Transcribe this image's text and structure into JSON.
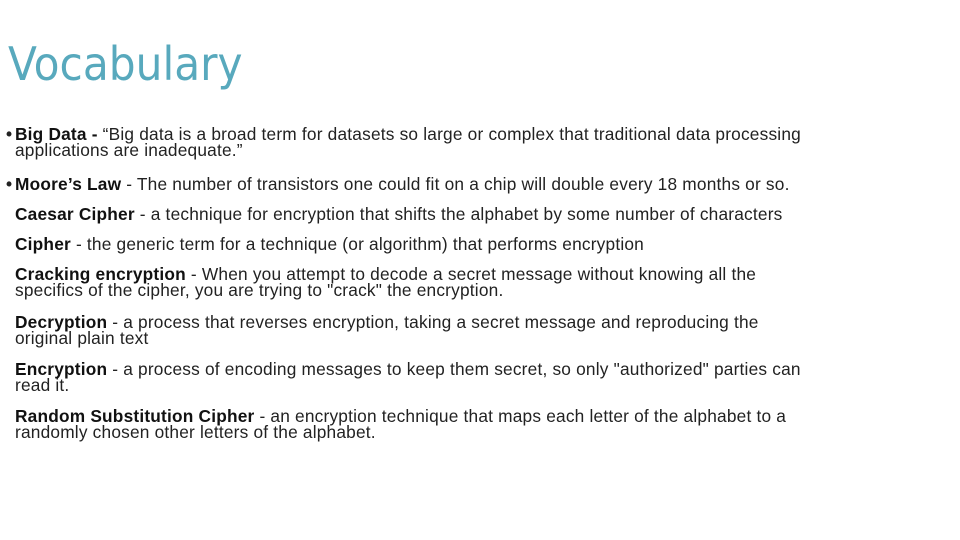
{
  "slide": {
    "title": "Vocabulary",
    "title_color": "#58a9bd",
    "entries": [
      {
        "bullet": "•",
        "term": "Big Data",
        "separator": " - ",
        "line1": "“Big data is a broad term for datasets so large or complex that traditional data processing",
        "line2": "applications are inadequate.”"
      },
      {
        "bullet": "•",
        "term": "Moore’s Law",
        "separator": " - ",
        "line1": "The number of transistors one could fit on a chip will double every 18 months or so.",
        "line2": ""
      },
      {
        "bullet": "",
        "term": "Caesar Cipher",
        "separator": " - ",
        "line1": "a technique for encryption that shifts the alphabet by some number of characters",
        "line2": ""
      },
      {
        "bullet": "",
        "term": "Cipher",
        "separator": " - ",
        "line1": "the generic term for a technique (or algorithm) that performs encryption",
        "line2": ""
      },
      {
        "bullet": "",
        "term": "Cracking encryption",
        "separator": " - ",
        "line1": "When you attempt to decode a secret message without knowing all the",
        "line2": "specifics of the cipher, you are trying to \"crack\" the encryption."
      },
      {
        "bullet": "",
        "term": "Decryption",
        "separator": " - ",
        "line1": "a process that reverses encryption, taking a secret message and reproducing the",
        "line2": "original plain text"
      },
      {
        "bullet": "",
        "term": "Encryption",
        "separator": " - ",
        "line1": "a process of encoding messages to keep them secret, so only \"authorized\" parties can",
        "line2": "read it."
      },
      {
        "bullet": "",
        "term": "Random Substitution Cipher",
        "separator": " - ",
        "line1": "an encryption technique that maps each letter of the alphabet to a",
        "line2": "randomly chosen other letters of the alphabet."
      }
    ]
  }
}
